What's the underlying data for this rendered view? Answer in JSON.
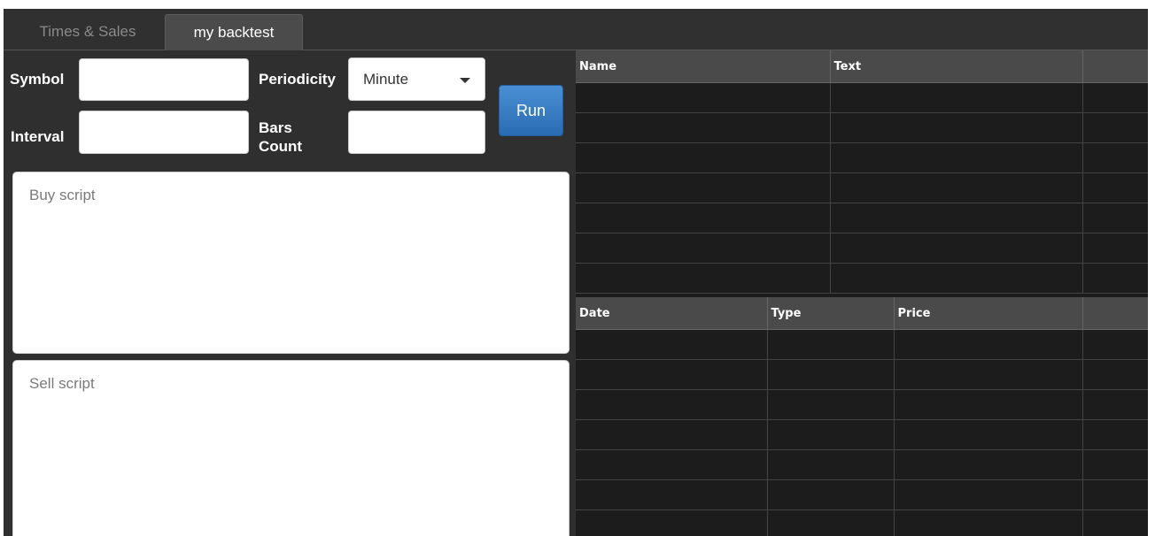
{
  "tabs": [
    {
      "label": "Times & Sales",
      "active": false
    },
    {
      "label": "my backtest",
      "active": true
    }
  ],
  "form": {
    "symbol_label": "Symbol",
    "symbol_value": "",
    "interval_label": "Interval",
    "interval_value": "",
    "periodicity_label": "Periodicity",
    "periodicity_value": "Minute",
    "bars_count_label_line1": "Bars",
    "bars_count_label_line2": "Count",
    "bars_count_value": "",
    "run_label": "Run"
  },
  "scripts": {
    "buy_placeholder": "Buy script",
    "sell_placeholder": "Sell script"
  },
  "messages_table": {
    "columns": [
      "Name",
      "Text",
      ""
    ],
    "rows": 7
  },
  "trades_table": {
    "columns": [
      "Date",
      "Type",
      "Price",
      ""
    ],
    "rows": 7
  },
  "colors": {
    "background": "#2f2f2f",
    "grid_background": "#1c1c1c",
    "header_background": "#4a4a4a",
    "run_button": "#2a6cb3"
  }
}
